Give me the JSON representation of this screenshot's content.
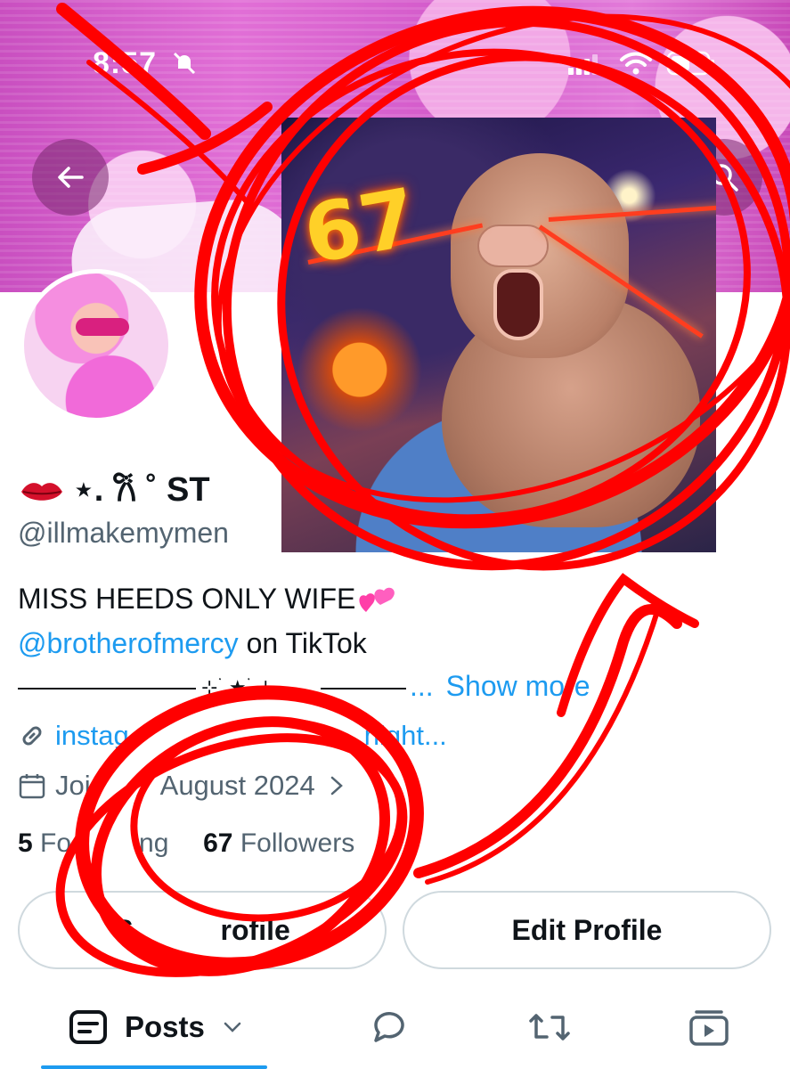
{
  "status_bar": {
    "time": "8:57"
  },
  "profile": {
    "display_name": "⋆. 𐙚 ˚ ST",
    "handle": "@illmakemymen",
    "bio_line1": "MISS HEEDS ONLY WIFE",
    "bio_mention": "@brotherofmercy",
    "bio_line2_rest": " on TikTok",
    "bio_ellipsis": "...",
    "show_more": "Show more",
    "link_text": "instag",
    "link_text_tail": "night...",
    "joined_partial": "Joi",
    "joined_month": "August 2024",
    "following_count": "5",
    "following_label": "Fo",
    "following_label_tail": "ng",
    "followers_count": "67",
    "followers_label": "Followers"
  },
  "buttons": {
    "share_profile_partial": "S",
    "share_profile_tail": "rofile",
    "edit_profile": "Edit Profile"
  },
  "tabs": {
    "posts_label": "Posts"
  },
  "meme": {
    "number_text": "67"
  },
  "colors": {
    "accent": "#1d9bf0",
    "scribble": "#ff0000",
    "banner": "#d45ccb"
  },
  "icons": [
    "back-arrow-icon",
    "search-icon",
    "bell-off-icon",
    "signal-icon",
    "wifi-icon",
    "battery-icon",
    "lips-icon",
    "hearts-icon",
    "link-icon",
    "calendar-icon",
    "posts-icon",
    "chevron-down-icon",
    "reply-icon",
    "repost-icon",
    "media-icon"
  ]
}
